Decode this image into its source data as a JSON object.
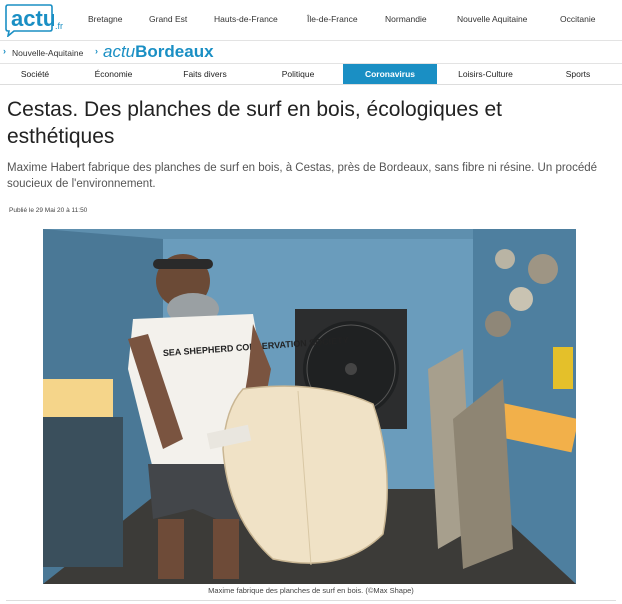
{
  "header": {
    "logo": "actu",
    "logo_tld": ".fr",
    "regions": [
      "Bretagne",
      "Grand Est",
      "Hauts-de-France",
      "Île-de-France",
      "Normandie",
      "Nouvelle Aquitaine",
      "Occitanie"
    ]
  },
  "breadcrumb": {
    "region": "Nouvelle-Aquitaine",
    "site_prefix": "actu",
    "site_name": "Bordeaux"
  },
  "categories": [
    {
      "label": "Société"
    },
    {
      "label": "Économie"
    },
    {
      "label": "Faits divers"
    },
    {
      "label": "Politique"
    },
    {
      "label": "Coronavirus",
      "active": true
    },
    {
      "label": "Loisirs-Culture"
    },
    {
      "label": "Sports"
    }
  ],
  "article": {
    "title": "Cestas. Des planches de surf en bois, écologiques et esthétiques",
    "lead": "Maxime Habert fabrique des planches de surf en bois, à Cestas, près de Bordeaux, sans fibre ni résine. Un procédé soucieux de l'environnement.",
    "published": "Publié le 29 Mai 20 à 11:50",
    "photo_caption": "Maxime fabrique des planches de surf en bois. (©Max Shape)",
    "shirt_text": "SEA SHEPHERD CONSERVATION SOCIETY"
  },
  "colors": {
    "brand": "#1a8fc4",
    "active_tab": "#1a8fc4"
  }
}
